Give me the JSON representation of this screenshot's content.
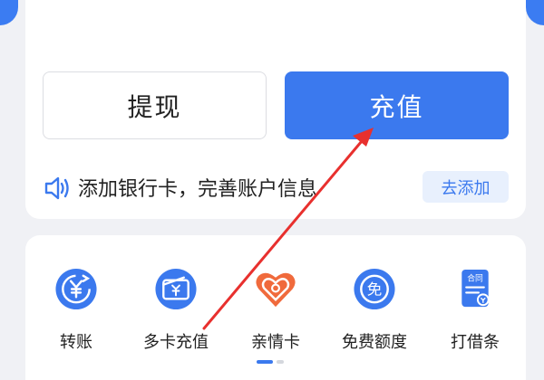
{
  "actions": {
    "withdraw_label": "提现",
    "recharge_label": "充值"
  },
  "notice": {
    "icon": "speaker-icon",
    "text": "添加银行卡，完善账户信息",
    "add_label": "去添加"
  },
  "services": [
    {
      "icon": "transfer-yen-icon",
      "label": "转账"
    },
    {
      "icon": "multi-card-wallet-icon",
      "label": "多卡充值"
    },
    {
      "icon": "heart-family-card-icon",
      "label": "亲情卡"
    },
    {
      "icon": "free-quota-icon",
      "label": "免费额度"
    },
    {
      "icon": "iou-contract-icon",
      "label": "打借条"
    }
  ],
  "free_icon_char": "免",
  "contract_icon_char": "合同",
  "colors": {
    "primary": "#3b79ee",
    "annotation_arrow": "#e8302e",
    "heart": "#f06a3c",
    "background": "#f0f1f5"
  },
  "pager": {
    "pages": 2,
    "active": 0
  }
}
